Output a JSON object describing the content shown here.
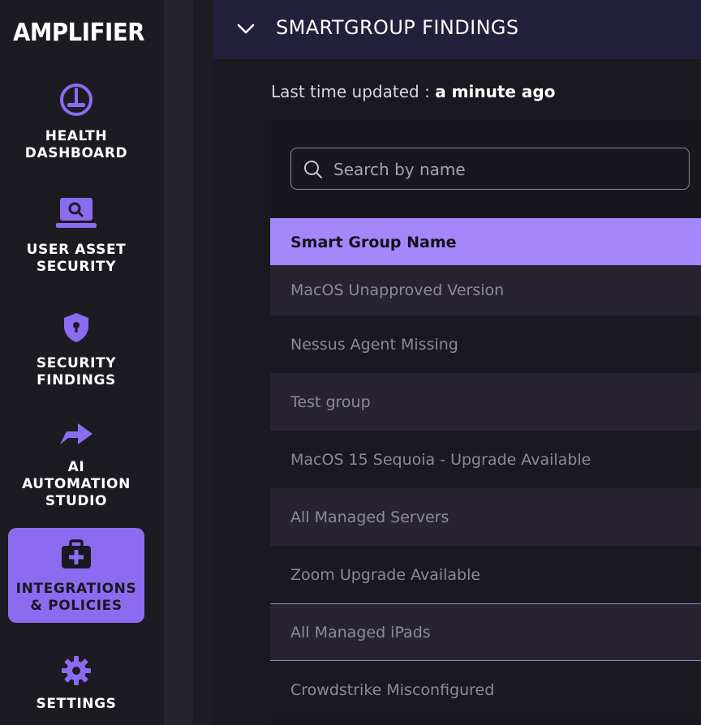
{
  "app": {
    "logo": "AMPLIFIER"
  },
  "sidebar": {
    "items": [
      {
        "label": "HEALTH\nDASHBOARD",
        "icon": "gauge-icon",
        "active": false
      },
      {
        "label": "USER ASSET\nSECURITY",
        "icon": "laptop-search-icon",
        "active": false
      },
      {
        "label": "SECURITY\nFINDINGS",
        "icon": "shield-lock-icon",
        "active": false
      },
      {
        "label": "AI\nAUTOMATION\nSTUDIO",
        "icon": "arrow-right-icon",
        "active": false
      },
      {
        "label": "INTEGRATIONS\n& POLICIES",
        "icon": "medical-kit-icon",
        "active": true
      },
      {
        "label": "SETTINGS",
        "icon": "gear-icon",
        "active": false
      }
    ]
  },
  "section": {
    "title": "SMARTGROUP FINDINGS",
    "last_updated_label": "Last time updated :",
    "last_updated_value": "a minute ago"
  },
  "search": {
    "placeholder": "Search by name",
    "value": ""
  },
  "table": {
    "header": "Smart Group Name",
    "rows": [
      "MacOS Unapproved Version",
      "Nessus Agent Missing",
      "Test group",
      "MacOS 15 Sequoia - Upgrade Available",
      "All Managed Servers",
      "Zoom Upgrade Available",
      "All Managed iPads",
      "Crowdstrike Misconfigured"
    ]
  },
  "colors": {
    "accent": "#8b6cf0",
    "header_accent": "#a387fb",
    "sidebar_bg": "#1d1b22",
    "header_bg": "#22203a",
    "row_alt_bg": "#27242f"
  }
}
